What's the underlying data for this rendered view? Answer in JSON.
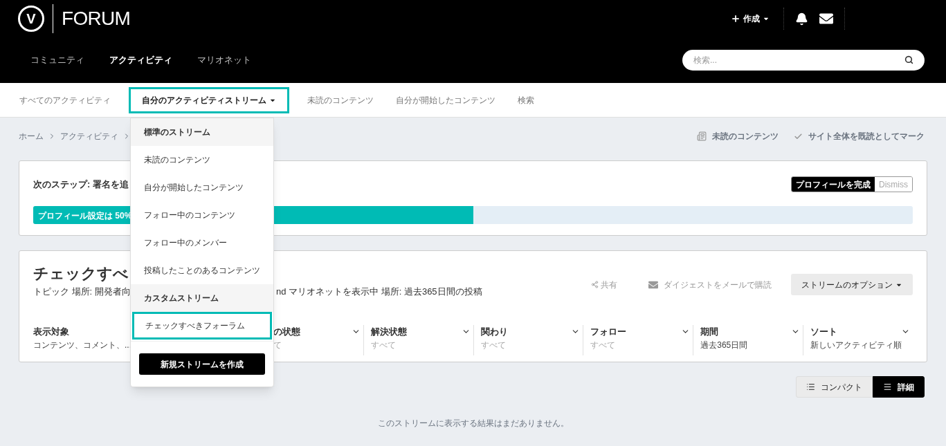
{
  "logo": {
    "mark": "V",
    "text": "FORUM"
  },
  "header_actions": {
    "create": "作成"
  },
  "nav": [
    {
      "label": "コミュニティ",
      "selected": false
    },
    {
      "label": "アクティビティ",
      "selected": true
    },
    {
      "label": "マリオネット",
      "selected": false
    }
  ],
  "search": {
    "placeholder": "検索..."
  },
  "subnav": [
    {
      "label": "すべてのアクティビティ",
      "selected": false,
      "dropdown": false
    },
    {
      "label": "自分のアクティビティストリーム",
      "selected": true,
      "dropdown": true
    },
    {
      "label": "未読のコンテンツ",
      "selected": false,
      "dropdown": false
    },
    {
      "label": "自分が開始したコンテンツ",
      "selected": false,
      "dropdown": false
    },
    {
      "label": "検索",
      "selected": false,
      "dropdown": false
    }
  ],
  "breadcrumb": [
    "ホーム",
    "アクティビティ"
  ],
  "page_actions": [
    "未読のコンテンツ",
    "サイト全体を既読としてマーク"
  ],
  "profile_card": {
    "title": "次のステップ: 署名を追",
    "complete_button": "プロフィールを完成",
    "dismiss_button": "Dismiss",
    "progress_label": "プロフィール設定は 50%",
    "level": 0.5
  },
  "stream": {
    "title": "チェックすべ",
    "description_left": "トピック 場所: 開発者向",
    "description_right": "nd マリオネットを表示中 場所: 過去365日間の投稿",
    "share": "共有",
    "digest": "ダイジェストをメールで購読",
    "options": "ストリームのオプション",
    "filters": [
      {
        "kind": "full",
        "label": "表示対象",
        "value": "コンテンツ、コメント、...",
        "muted": false
      },
      {
        "kind": "partial",
        "label": "の状態",
        "value": "て",
        "muted": true
      },
      {
        "kind": "full",
        "label": "解決状態",
        "value": "すべて",
        "muted": true
      },
      {
        "kind": "full",
        "label": "関わり",
        "value": "すべて",
        "muted": true
      },
      {
        "kind": "full",
        "label": "フォロー",
        "value": "すべて",
        "muted": true
      },
      {
        "kind": "full",
        "label": "期間",
        "value": "過去365日間",
        "muted": false
      },
      {
        "kind": "full",
        "label": "ソート",
        "value": "新しいアクティビティ順",
        "muted": false
      }
    ]
  },
  "view_toggle": [
    {
      "label": "コンパクト",
      "selected": false,
      "kind": "compact"
    },
    {
      "label": "詳細",
      "selected": true,
      "kind": "detail"
    }
  ],
  "empty_message": "このストリームに表示する結果はまだありません。",
  "dropdown": [
    {
      "kind": "header",
      "label": "標準のストリーム",
      "selected": false
    },
    {
      "kind": "item",
      "label": "未読のコンテンツ",
      "selected": false
    },
    {
      "kind": "item",
      "label": "自分が開始したコンテンツ",
      "selected": false
    },
    {
      "kind": "item",
      "label": "フォロー中のコンテンツ",
      "selected": false
    },
    {
      "kind": "item",
      "label": "フォロー中のメンバー",
      "selected": false
    },
    {
      "kind": "item",
      "label": "投稿したことのあるコンテンツ",
      "selected": false
    },
    {
      "kind": "header",
      "label": "カスタムストリーム",
      "selected": false
    },
    {
      "kind": "item",
      "label": "チェックすべきフォーラム",
      "selected": true
    },
    {
      "kind": "button",
      "label": "新規ストリームを作成",
      "selected": false
    }
  ]
}
